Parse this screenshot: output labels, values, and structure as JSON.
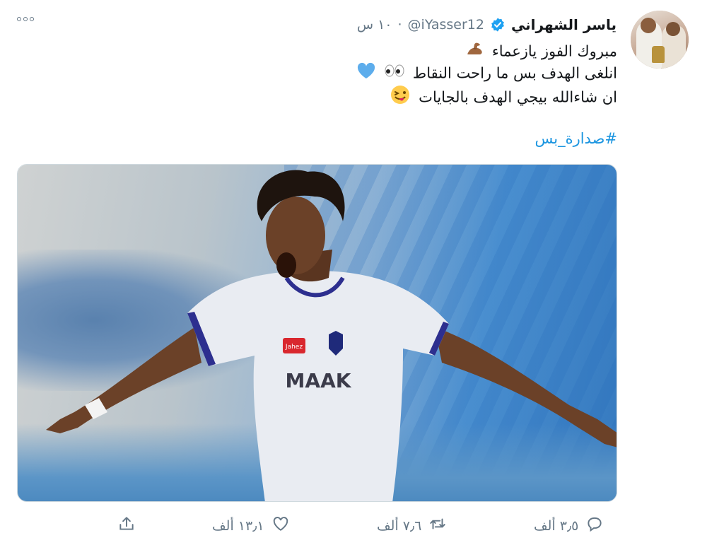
{
  "tweet": {
    "author": {
      "name": "ياسر الشهراني",
      "handle": "@iYasser12",
      "verified": true
    },
    "time": "١٠ س",
    "separator": "·",
    "lines": [
      {
        "text": "مبروك الفوز يازعماء",
        "emoji": "flexed-biceps"
      },
      {
        "text": "انلغى الهدف بس ما راحت النقاط",
        "emoji": "eyes-blue-heart"
      },
      {
        "text": "ان شاءالله بيجي الهدف بالجايات",
        "emoji": "winking-tongue-face"
      }
    ],
    "hashtag": "#صدارة_بس",
    "media": {
      "description": "player celebrating",
      "kit_sponsor": "MAAK",
      "badge": "Jahez"
    }
  },
  "actions": {
    "reply": {
      "icon": "reply-icon",
      "count": "٣٫٥ ألف"
    },
    "retweet": {
      "icon": "retweet-icon",
      "count": "٧٫٦ ألف"
    },
    "like": {
      "icon": "heart-icon",
      "count": "١٣٫١ ألف"
    },
    "share": {
      "icon": "share-icon"
    }
  },
  "colors": {
    "link": "#1b95e0",
    "muted": "#657786",
    "verified": "#1da1f2"
  }
}
